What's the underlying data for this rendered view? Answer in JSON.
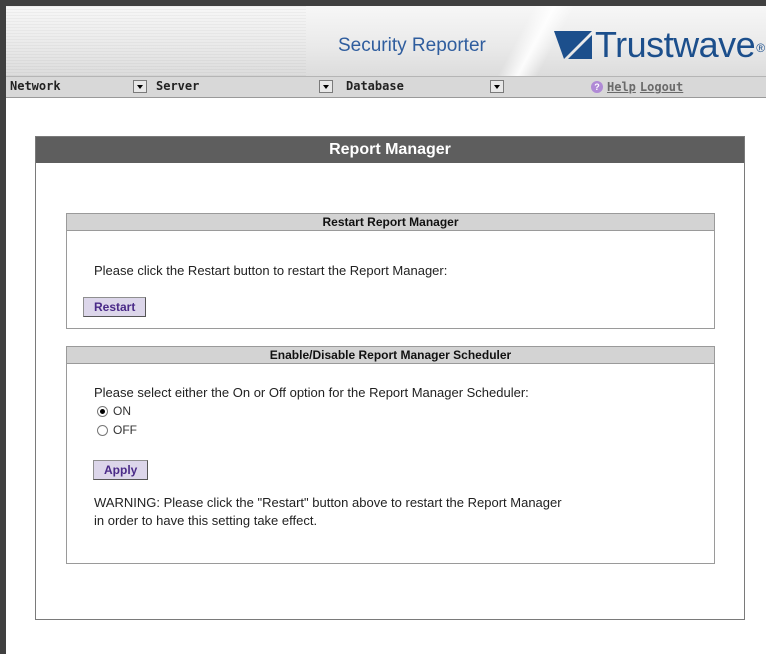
{
  "header": {
    "app_title": "Security Reporter",
    "brand_name": "Trustwave",
    "brand_tm": "®"
  },
  "menu": {
    "network": "Network",
    "server": "Server",
    "database": "Database",
    "help": "Help",
    "logout": "Logout"
  },
  "panel": {
    "title": "Report Manager"
  },
  "restart_section": {
    "title": "Restart Report Manager",
    "instruction": "Please click the Restart button to restart the Report Manager:",
    "button_label": "Restart"
  },
  "scheduler_section": {
    "title": "Enable/Disable Report Manager Scheduler",
    "instruction": "Please select either the On or Off option for the Report Manager Scheduler:",
    "option_on": "ON",
    "option_off": "OFF",
    "selected": "ON",
    "button_label": "Apply",
    "warning_line1": "WARNING: Please click the \"Restart\" button above to restart the Report Manager",
    "warning_line2": "in order to have this setting take effect."
  },
  "colors": {
    "brand": "#1c4f8c",
    "panel_header": "#5e5e5e",
    "button_text": "#4a2a88"
  }
}
